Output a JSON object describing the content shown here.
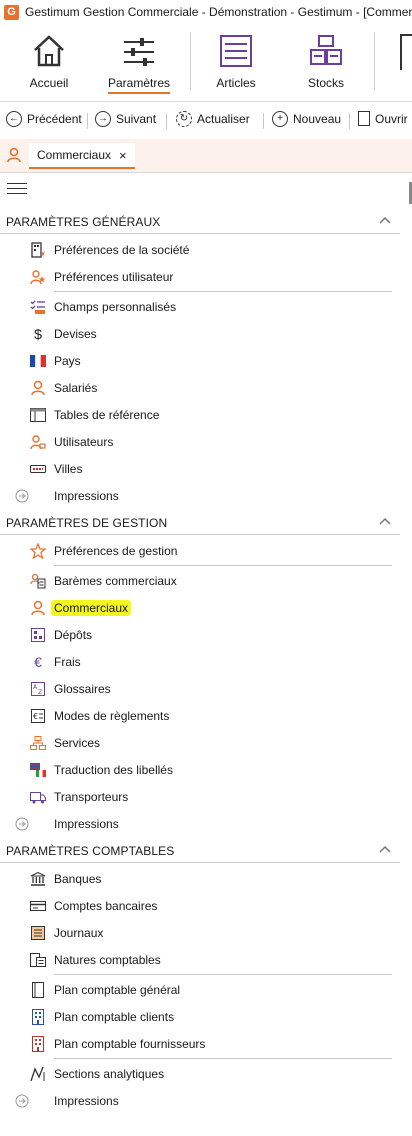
{
  "window": {
    "title": "Gestimum Gestion Commerciale - Démonstration - Gestimum - [Commer",
    "app_icon": "G"
  },
  "ribbon": {
    "tabs": [
      {
        "label": "Accueil",
        "icon": "house-icon"
      },
      {
        "label": "Paramètres",
        "icon": "sliders-icon",
        "active": true
      },
      {
        "label": "Articles",
        "icon": "list-icon"
      },
      {
        "label": "Stocks",
        "icon": "boxes-icon"
      }
    ]
  },
  "toolbar": {
    "precedent": "Précédent",
    "suivant": "Suivant",
    "actualiser": "Actualiser",
    "nouveau": "Nouveau",
    "ouvrir": "Ouvrir"
  },
  "doc_tab": {
    "label": "Commerciaux",
    "close": "×"
  },
  "sections": {
    "generaux": {
      "title": "PARAMÈTRES GÉNÉRAUX",
      "items": [
        "Préférences de la société",
        "Préférences utilisateur",
        "Champs personnalisés",
        "Devises",
        "Pays",
        "Salariés",
        "Tables de référence",
        "Utilisateurs",
        "Villes",
        "Impressions"
      ]
    },
    "gestion": {
      "title": "PARAMÈTRES DE GESTION",
      "items": [
        "Préférences de gestion",
        "Barèmes commerciaux",
        "Commerciaux",
        "Dépôts",
        "Frais",
        "Glossaires",
        "Modes de règlements",
        "Services",
        "Traduction des libellés",
        "Transporteurs",
        "Impressions"
      ]
    },
    "comptables": {
      "title": "PARAMÈTRES COMPTABLES",
      "items": [
        "Banques",
        "Comptes bancaires",
        "Journaux",
        "Natures comptables",
        "Plan comptable général",
        "Plan comptable clients",
        "Plan comptable fournisseurs",
        "Sections analytiques",
        "Impressions"
      ]
    }
  },
  "colors": {
    "accent": "#e8722a",
    "highlight": "#f5f520",
    "tabstrip": "#fdf1ec",
    "purple": "#6b3fa0"
  }
}
